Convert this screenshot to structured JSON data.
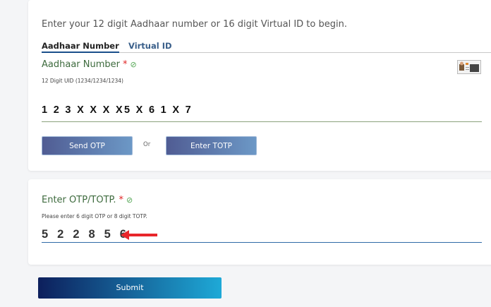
{
  "intro_text": "Enter your 12 digit Aadhaar number or 16 digit Virtual ID to begin.",
  "tabs": [
    {
      "label": "Aadhaar Number",
      "active": true
    },
    {
      "label": "Virtual ID",
      "active": false
    }
  ],
  "aadhaar": {
    "label": "Aadhaar Number",
    "required_mark": "*",
    "valid_icon": "check-circle-icon",
    "hint": "12 Digit UID (1234/1234/1234)",
    "value": "1 2 3 X X X X5 X 6 1 X 7",
    "side_icon": "id-card-icon"
  },
  "actions": {
    "send_otp_label": "Send OTP",
    "or_label": "Or",
    "enter_totp_label": "Enter TOTP"
  },
  "otp": {
    "label": "Enter OTP/TOTP.",
    "required_mark": "*",
    "valid_icon": "check-circle-icon",
    "hint": "Please enter 6 digit OTP or 8 digit TOTP.",
    "value": "5 2 2 8 5 6",
    "annotation_icon": "red-arrow-icon"
  },
  "submit_label": "Submit",
  "colors": {
    "label_green": "#3e6b3e",
    "required_red": "#e02424",
    "tab_underline": "#1a4f8b",
    "button_start": "#505c93",
    "button_end": "#6c98c6",
    "submit_start": "#0d1f5c",
    "submit_end": "#1ea9d7"
  }
}
